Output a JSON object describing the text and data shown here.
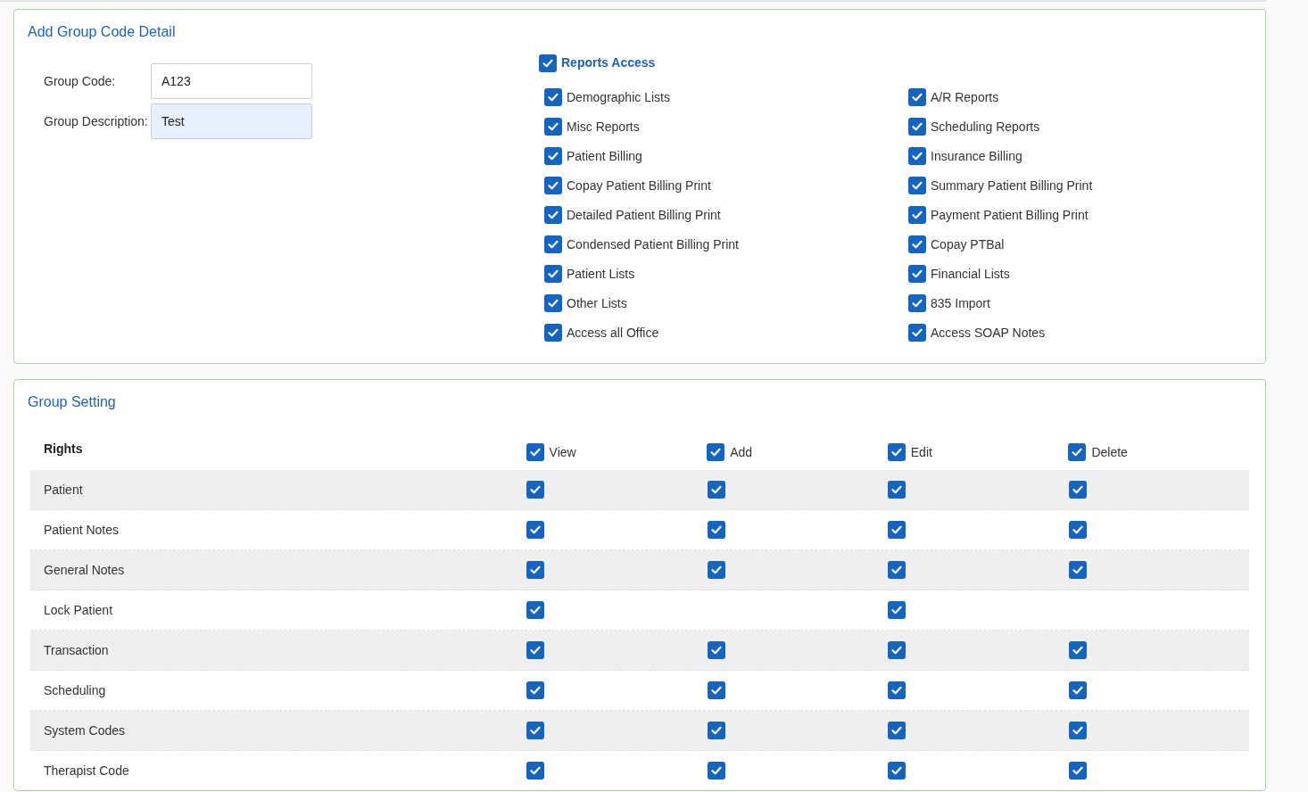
{
  "group_code_detail": {
    "title": "Add Group Code Detail",
    "fields": [
      {
        "label": "Group Code:",
        "value": "A123",
        "highlighted": false
      },
      {
        "label": "Group Description:",
        "value": "Test",
        "highlighted": true
      }
    ],
    "reports_access": {
      "label": "Reports Access",
      "checked": true,
      "columns": [
        {
          "items": [
            {
              "label": "Demographic Lists",
              "checked": true
            },
            {
              "label": "Misc Reports",
              "checked": true
            },
            {
              "label": "Patient Billing",
              "checked": true
            },
            {
              "label": "Copay Patient Billing Print",
              "checked": true
            },
            {
              "label": "Detailed Patient Billing Print",
              "checked": true
            },
            {
              "label": "Condensed Patient Billing Print",
              "checked": true
            },
            {
              "label": "Patient Lists",
              "checked": true
            },
            {
              "label": "Other Lists",
              "checked": true
            },
            {
              "label": "Access all Office",
              "checked": true
            }
          ]
        },
        {
          "items": [
            {
              "label": "A/R Reports",
              "checked": true
            },
            {
              "label": "Scheduling Reports",
              "checked": true
            },
            {
              "label": "Insurance Billing",
              "checked": true
            },
            {
              "label": "Summary Patient Billing Print",
              "checked": true
            },
            {
              "label": "Payment Patient Billing Print",
              "checked": true
            },
            {
              "label": "Copay PTBal",
              "checked": true
            },
            {
              "label": "Financial Lists",
              "checked": true
            },
            {
              "label": "835 Import",
              "checked": true
            },
            {
              "label": "Access SOAP Notes",
              "checked": true
            }
          ]
        }
      ]
    }
  },
  "group_setting": {
    "title": "Group Setting",
    "rights_label": "Rights",
    "columns": [
      {
        "label": "View",
        "checked": true
      },
      {
        "label": "Add",
        "checked": true
      },
      {
        "label": "Edit",
        "checked": true
      },
      {
        "label": "Delete",
        "checked": true
      }
    ],
    "rows": [
      {
        "name": "Patient",
        "cells": [
          {
            "kind": "checkbox",
            "checked": true
          },
          {
            "kind": "checkbox",
            "checked": true
          },
          {
            "kind": "checkbox",
            "checked": true
          },
          {
            "kind": "checkbox",
            "checked": true
          }
        ]
      },
      {
        "name": "Patient Notes",
        "cells": [
          {
            "kind": "checkbox",
            "checked": true
          },
          {
            "kind": "checkbox",
            "checked": true
          },
          {
            "kind": "checkbox",
            "checked": true
          },
          {
            "kind": "checkbox",
            "checked": true
          }
        ]
      },
      {
        "name": "General Notes",
        "cells": [
          {
            "kind": "checkbox",
            "checked": true
          },
          {
            "kind": "checkbox",
            "checked": true
          },
          {
            "kind": "checkbox",
            "checked": true
          },
          {
            "kind": "checkbox",
            "checked": true
          }
        ]
      },
      {
        "name": "Lock Patient",
        "cells": [
          {
            "kind": "checkbox",
            "checked": true
          },
          {
            "kind": "empty"
          },
          {
            "kind": "checkbox",
            "checked": true
          },
          {
            "kind": "empty"
          }
        ]
      },
      {
        "name": "Transaction",
        "cells": [
          {
            "kind": "checkbox",
            "checked": true
          },
          {
            "kind": "checkbox",
            "checked": true
          },
          {
            "kind": "checkbox",
            "checked": true
          },
          {
            "kind": "checkbox",
            "checked": true
          }
        ]
      },
      {
        "name": "Scheduling",
        "cells": [
          {
            "kind": "checkbox",
            "checked": true
          },
          {
            "kind": "checkbox",
            "checked": true
          },
          {
            "kind": "checkbox",
            "checked": true
          },
          {
            "kind": "checkbox",
            "checked": true
          }
        ]
      },
      {
        "name": "System Codes",
        "cells": [
          {
            "kind": "checkbox",
            "checked": true
          },
          {
            "kind": "checkbox",
            "checked": true
          },
          {
            "kind": "checkbox",
            "checked": true
          },
          {
            "kind": "checkbox",
            "checked": true
          }
        ]
      },
      {
        "name": "Therapist Code",
        "cells": [
          {
            "kind": "checkbox",
            "checked": true
          },
          {
            "kind": "checkbox",
            "checked": true
          },
          {
            "kind": "checkbox",
            "checked": true
          },
          {
            "kind": "checkbox",
            "checked": true
          }
        ]
      }
    ]
  }
}
